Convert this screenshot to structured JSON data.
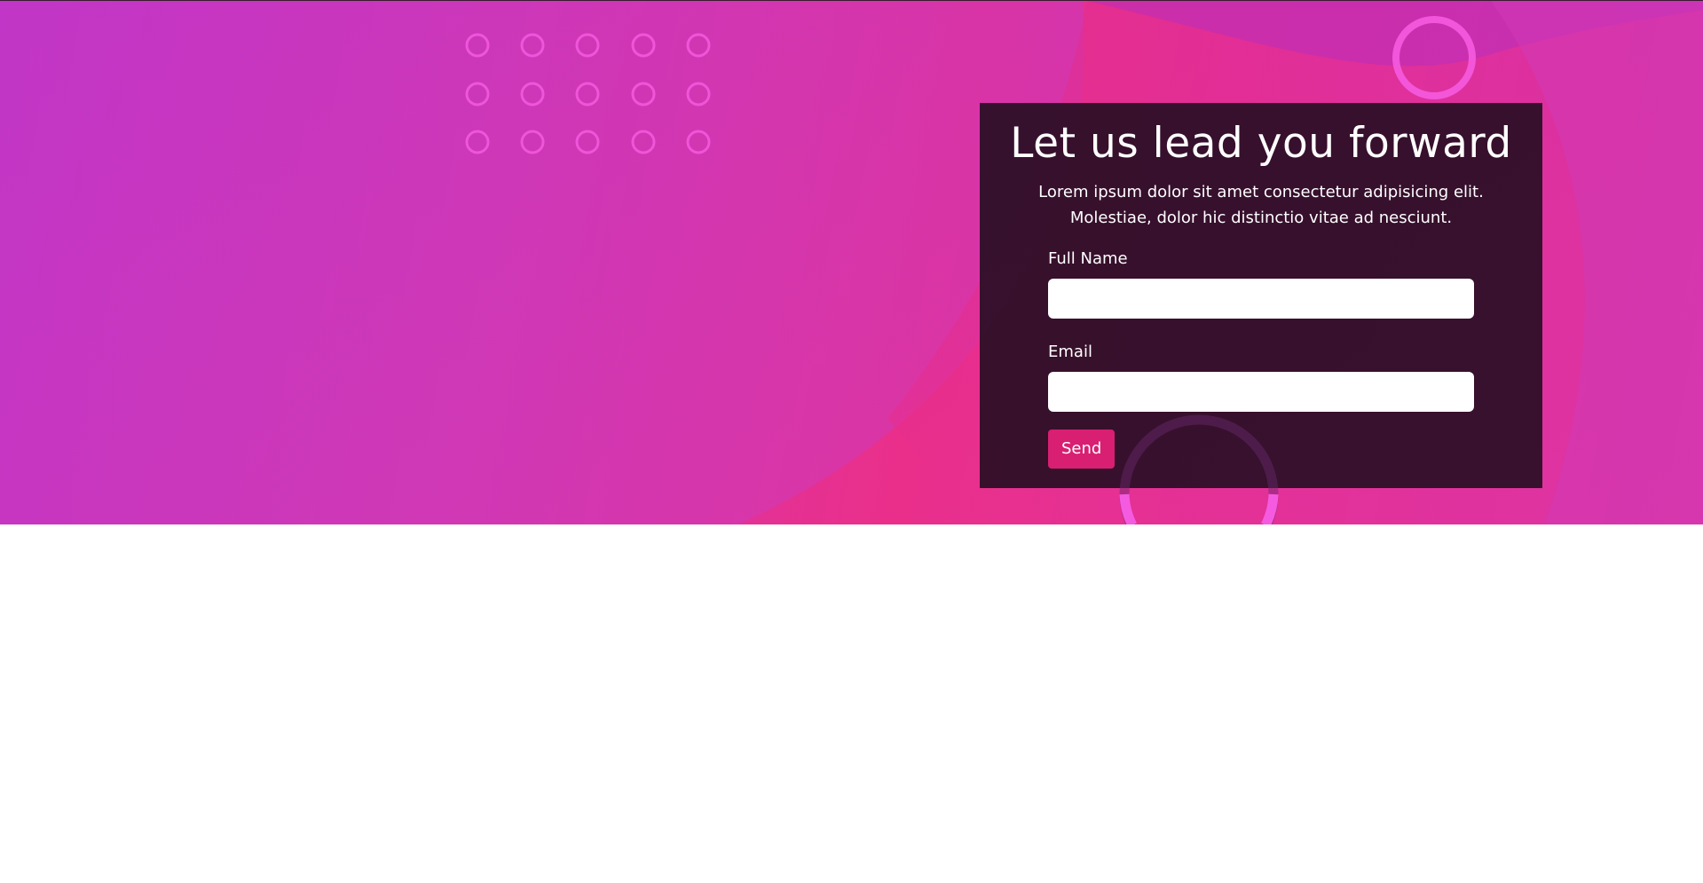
{
  "hero": {
    "title": "Let us lead you forward",
    "description": "Lorem ipsum dolor sit amet consectetur adipisicing elit. Molestiae, dolor hic distinctio vitae ad nesciunt."
  },
  "form": {
    "name_label": "Full Name",
    "name_value": "",
    "email_label": "Email",
    "email_value": "",
    "send_label": "Send"
  },
  "colors": {
    "hero_gradient_start": "#bf34c8",
    "hero_gradient_mid": "#ea2f8a",
    "card_background": "#280e24",
    "send_button": "#d81f72",
    "decor_ring": "#f55be0"
  },
  "decorations": {
    "dot_grid": "ring-dot-grid",
    "rings": [
      "large-ring-top-right",
      "large-ring-bottom"
    ]
  }
}
